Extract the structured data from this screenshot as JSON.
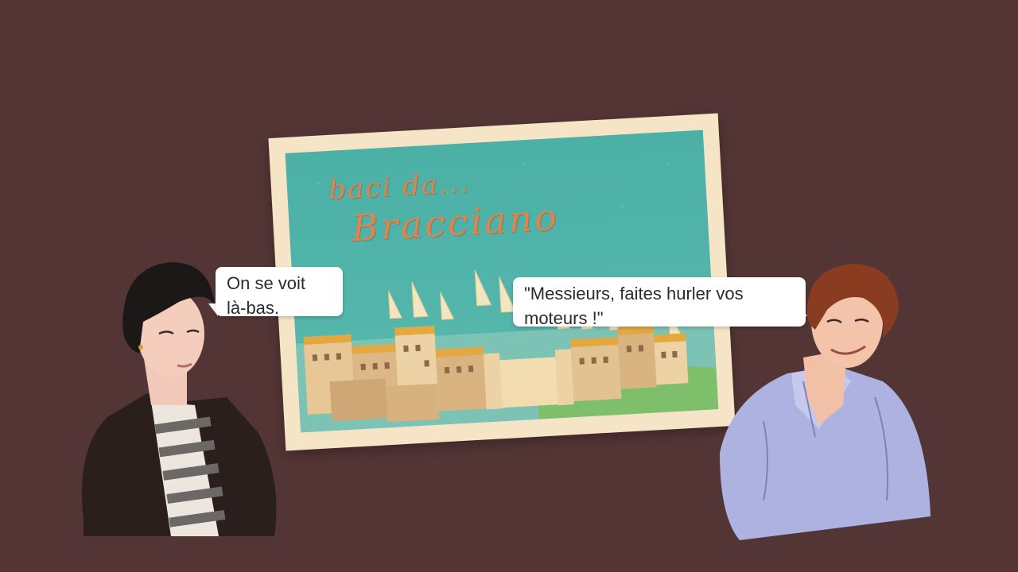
{
  "postcard": {
    "greeting": "baci da...",
    "place": "Bracciano"
  },
  "dialogue": {
    "left": {
      "line1": "On se voit",
      "line2": "là-bas."
    },
    "right": {
      "line1": "\"Messieurs, faites hurler vos",
      "line2": "moteurs !\""
    }
  },
  "colors": {
    "background": "#533535",
    "postcard_frame": "#f6e4c6",
    "sky": "#4bb0a6",
    "title_text": "#e0834c"
  }
}
